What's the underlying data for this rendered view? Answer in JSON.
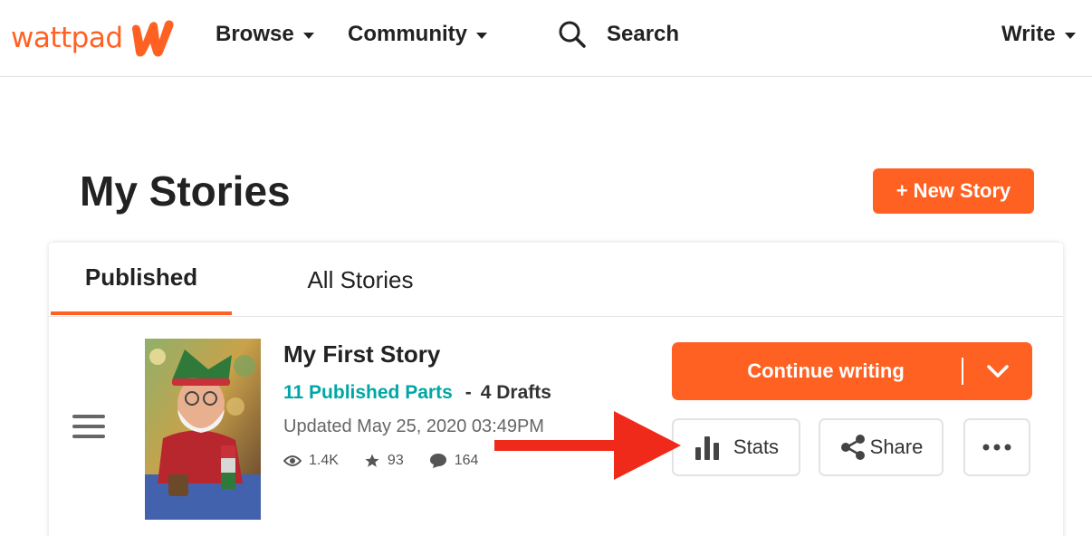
{
  "brand": {
    "logo_text": "wattpad",
    "color": "#ff6122"
  },
  "nav": {
    "browse": "Browse",
    "community": "Community",
    "search": "Search",
    "write": "Write"
  },
  "page": {
    "title": "My Stories",
    "new_story": "+ New Story"
  },
  "tabs": [
    {
      "label": "Published",
      "active": true
    },
    {
      "label": "All Stories",
      "active": false
    }
  ],
  "story": {
    "title": "My First Story",
    "published_parts": "11 Published Parts",
    "separator": "-",
    "drafts": "4 Drafts",
    "updated": "Updated May 25, 2020 03:49PM",
    "reads": "1.4K",
    "votes": "93",
    "comments": "164"
  },
  "actions": {
    "continue_writing": "Continue writing",
    "stats": "Stats",
    "share": "Share"
  },
  "colors": {
    "accent": "#ff6122",
    "teal": "#00a6a6",
    "annotation_arrow": "#f02a1a"
  },
  "icons": [
    "search-icon",
    "caret-down-icon",
    "drag-handle-icon",
    "eye-icon",
    "star-icon",
    "comment-icon",
    "chevron-down-icon",
    "bar-chart-icon",
    "share-icon",
    "more-dots-icon",
    "red-arrow-annotation"
  ]
}
